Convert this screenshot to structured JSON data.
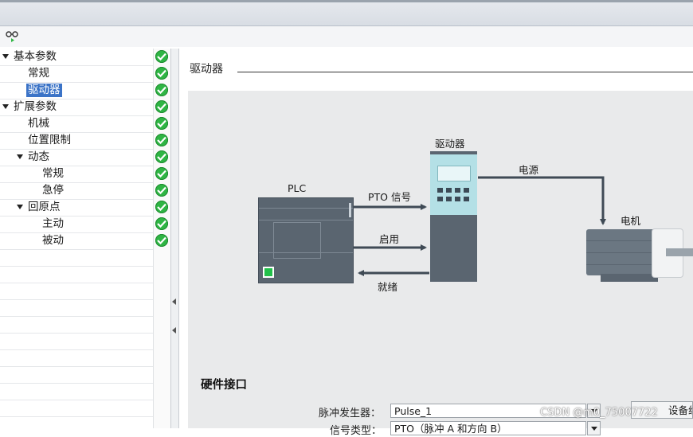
{
  "tree": {
    "items": [
      {
        "label": "基本参数",
        "level": 0,
        "expanded": true
      },
      {
        "label": "常规",
        "level": 1
      },
      {
        "label": "驱动器",
        "level": 1,
        "selected": true
      },
      {
        "label": "扩展参数",
        "level": 0,
        "expanded": true
      },
      {
        "label": "机械",
        "level": 1
      },
      {
        "label": "位置限制",
        "level": 1
      },
      {
        "label": "动态",
        "level": 1,
        "expanded": true
      },
      {
        "label": "常规",
        "level": 2
      },
      {
        "label": "急停",
        "level": 2
      },
      {
        "label": "回原点",
        "level": 1,
        "expanded": true
      },
      {
        "label": "主动",
        "level": 2
      },
      {
        "label": "被动",
        "level": 2
      }
    ]
  },
  "section": {
    "title": "驱动器"
  },
  "diagram": {
    "plc_label": "PLC",
    "drive_label": "驱动器",
    "power_label": "电源",
    "motor_label": "电机",
    "pto_label": "PTO 信号",
    "enable_label": "启用",
    "ready_label": "就绪"
  },
  "hardware": {
    "title": "硬件接口",
    "pulse_label": "脉冲发生器：",
    "pulse_value": "Pulse_1",
    "signal_label": "信号类型：",
    "signal_value": "PTO（脉冲 A 和方向 B）",
    "device_button": "设备组"
  },
  "watermark": "CSDN @m0_75007722",
  "colors": {
    "check": "#2fb544",
    "selection": "#3b73c7",
    "device_dark": "#5a6570",
    "drive_panel": "#b4e0e6"
  }
}
